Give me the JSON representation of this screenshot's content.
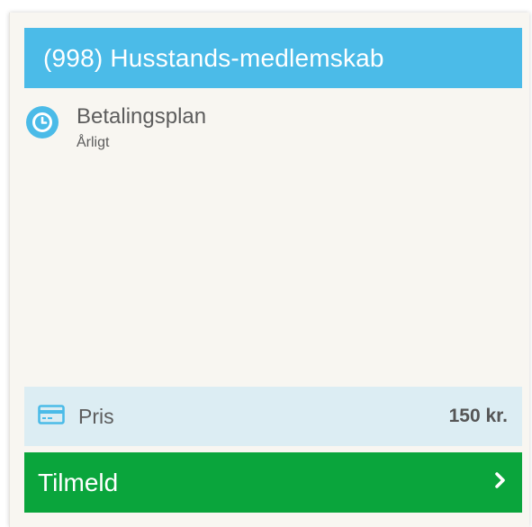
{
  "card": {
    "title": "(998) Husstands-medlemskab",
    "plan": {
      "label": "Betalingsplan",
      "value": "Årligt",
      "icon": "clock-icon"
    },
    "price": {
      "label": "Pris",
      "value": "150 kr.",
      "icon": "credit-card-icon"
    },
    "button": {
      "label": "Tilmeld",
      "icon": "chevron-right-icon"
    }
  },
  "colors": {
    "header": "#4bbbe8",
    "card_background": "#f8f6f1",
    "price_background": "#dcedf3",
    "button": "#0aa53c",
    "text": "#5d5d5d"
  }
}
